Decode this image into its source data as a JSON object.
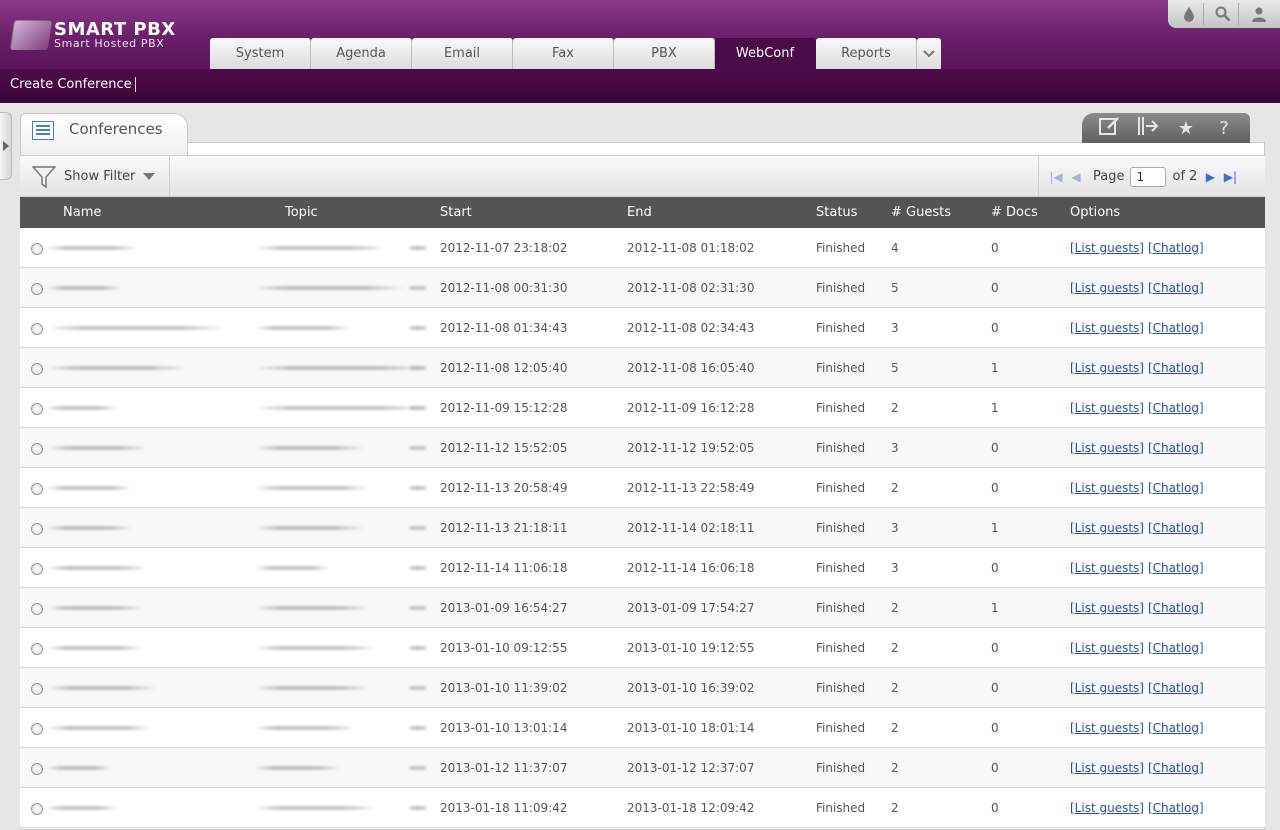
{
  "app": {
    "logo_title": "SMART PBX",
    "logo_subtitle": "Smart Hosted PBX"
  },
  "colors": {
    "brand": "#6a1f6a",
    "active_tab": "#4b0a48",
    "link": "#2a4da0"
  },
  "tabs": [
    {
      "label": "System",
      "active": false
    },
    {
      "label": "Agenda",
      "active": false
    },
    {
      "label": "Email",
      "active": false
    },
    {
      "label": "Fax",
      "active": false
    },
    {
      "label": "PBX",
      "active": false
    },
    {
      "label": "WebConf",
      "active": true
    },
    {
      "label": "Reports",
      "active": false
    }
  ],
  "top_tools": [
    "drop-icon",
    "search-icon",
    "user-icon"
  ],
  "subbar": {
    "create_conference": "Create Conference"
  },
  "panel": {
    "title": "Conferences"
  },
  "panel_tools": [
    "edit-icon",
    "export-icon",
    "star-icon",
    "help-icon"
  ],
  "filter": {
    "label": "Show Filter"
  },
  "pager": {
    "page_label": "Page",
    "page_value": "1",
    "of_label": "of 2"
  },
  "columns": {
    "name": "Name",
    "topic": "Topic",
    "start": "Start",
    "end": "End",
    "status": "Status",
    "guests": "# Guests",
    "docs": "# Docs",
    "options": "Options"
  },
  "link_labels": {
    "list_guests": "[List guests]",
    "chatlog": "[Chatlog]"
  },
  "rows": [
    {
      "start": "2012-11-07 23:18:02",
      "end": "2012-11-08 01:18:02",
      "status": "Finished",
      "guests": "4",
      "docs": "0"
    },
    {
      "start": "2012-11-08 00:31:30",
      "end": "2012-11-08 02:31:30",
      "status": "Finished",
      "guests": "5",
      "docs": "0"
    },
    {
      "start": "2012-11-08 01:34:43",
      "end": "2012-11-08 02:34:43",
      "status": "Finished",
      "guests": "3",
      "docs": "0"
    },
    {
      "start": "2012-11-08 12:05:40",
      "end": "2012-11-08 16:05:40",
      "status": "Finished",
      "guests": "5",
      "docs": "1"
    },
    {
      "start": "2012-11-09 15:12:28",
      "end": "2012-11-09 16:12:28",
      "status": "Finished",
      "guests": "2",
      "docs": "1"
    },
    {
      "start": "2012-11-12 15:52:05",
      "end": "2012-11-12 19:52:05",
      "status": "Finished",
      "guests": "3",
      "docs": "0"
    },
    {
      "start": "2012-11-13 20:58:49",
      "end": "2012-11-13 22:58:49",
      "status": "Finished",
      "guests": "2",
      "docs": "0"
    },
    {
      "start": "2012-11-13 21:18:11",
      "end": "2012-11-14 02:18:11",
      "status": "Finished",
      "guests": "3",
      "docs": "1"
    },
    {
      "start": "2012-11-14 11:06:18",
      "end": "2012-11-14 16:06:18",
      "status": "Finished",
      "guests": "3",
      "docs": "0"
    },
    {
      "start": "2013-01-09 16:54:27",
      "end": "2013-01-09 17:54:27",
      "status": "Finished",
      "guests": "2",
      "docs": "1"
    },
    {
      "start": "2013-01-10 09:12:55",
      "end": "2013-01-10 19:12:55",
      "status": "Finished",
      "guests": "2",
      "docs": "0"
    },
    {
      "start": "2013-01-10 11:39:02",
      "end": "2013-01-10 16:39:02",
      "status": "Finished",
      "guests": "2",
      "docs": "0"
    },
    {
      "start": "2013-01-10 13:01:14",
      "end": "2013-01-10 18:01:14",
      "status": "Finished",
      "guests": "2",
      "docs": "0"
    },
    {
      "start": "2013-01-12 11:37:07",
      "end": "2013-01-12 12:37:07",
      "status": "Finished",
      "guests": "2",
      "docs": "0"
    },
    {
      "start": "2013-01-18 11:09:42",
      "end": "2013-01-18 12:09:42",
      "status": "Finished",
      "guests": "2",
      "docs": "0"
    }
  ]
}
